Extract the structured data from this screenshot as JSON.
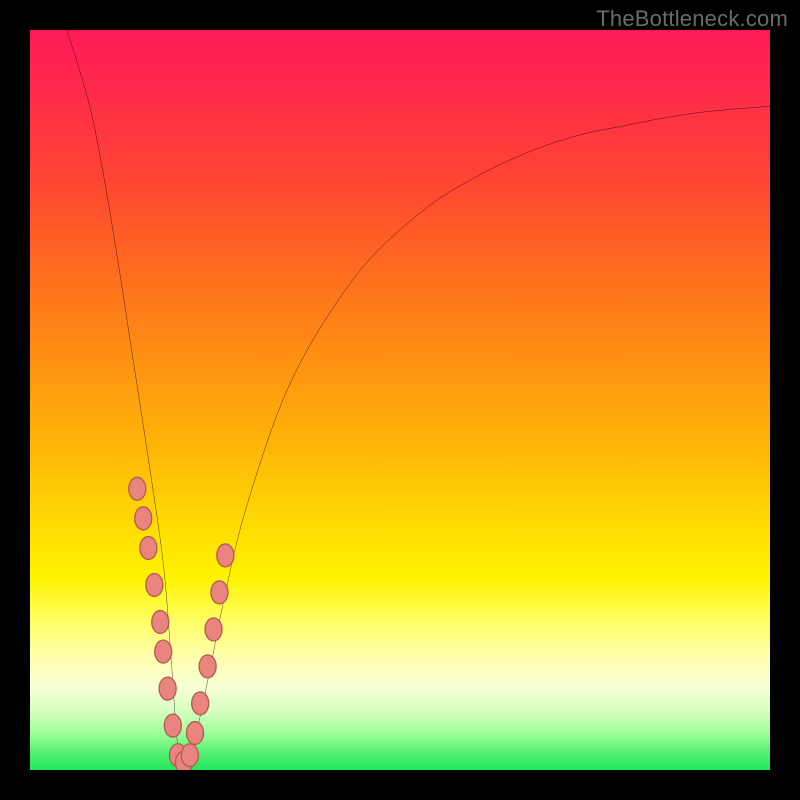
{
  "watermark": "TheBottleneck.com",
  "colors": {
    "frame_bg": "#000000",
    "curve_stroke": "#000000",
    "marker_fill": "#e9847f",
    "marker_stroke": "#b55a55"
  },
  "chart_data": {
    "type": "line",
    "title": "",
    "xlabel": "",
    "ylabel": "",
    "xlim": [
      0,
      100
    ],
    "ylim": [
      0,
      100
    ],
    "grid": false,
    "legend": false,
    "note": "Bottleneck-percentage style V-curve; x is relative hardware score, y is bottleneck %. Min near x≈20, y≈0. No numeric tick labels are shown in the image; values below are read off the curve geometry.",
    "series": [
      {
        "name": "bottleneck-curve",
        "x": [
          5,
          8,
          10,
          12,
          14,
          16,
          18,
          19,
          20,
          21,
          22,
          24,
          26,
          28,
          30,
          33,
          36,
          40,
          45,
          50,
          55,
          60,
          65,
          70,
          75,
          80,
          85,
          90,
          95,
          100
        ],
        "y": [
          100,
          90,
          80,
          68,
          55,
          42,
          28,
          16,
          3,
          1,
          3,
          12,
          22,
          31,
          38,
          47,
          54,
          61,
          68,
          73,
          77,
          80,
          82.5,
          84.5,
          86,
          87,
          88,
          88.8,
          89.3,
          89.7
        ]
      }
    ],
    "markers": {
      "name": "highlighted-points",
      "x": [
        14.5,
        15.3,
        16.0,
        16.8,
        17.6,
        18.0,
        18.6,
        19.3,
        20.0,
        20.8,
        21.6,
        22.3,
        23.0,
        24.0,
        24.8,
        25.6,
        26.4
      ],
      "y": [
        38,
        34,
        30,
        25,
        20,
        16,
        11,
        6,
        2,
        1,
        2,
        5,
        9,
        14,
        19,
        24,
        29
      ]
    }
  }
}
